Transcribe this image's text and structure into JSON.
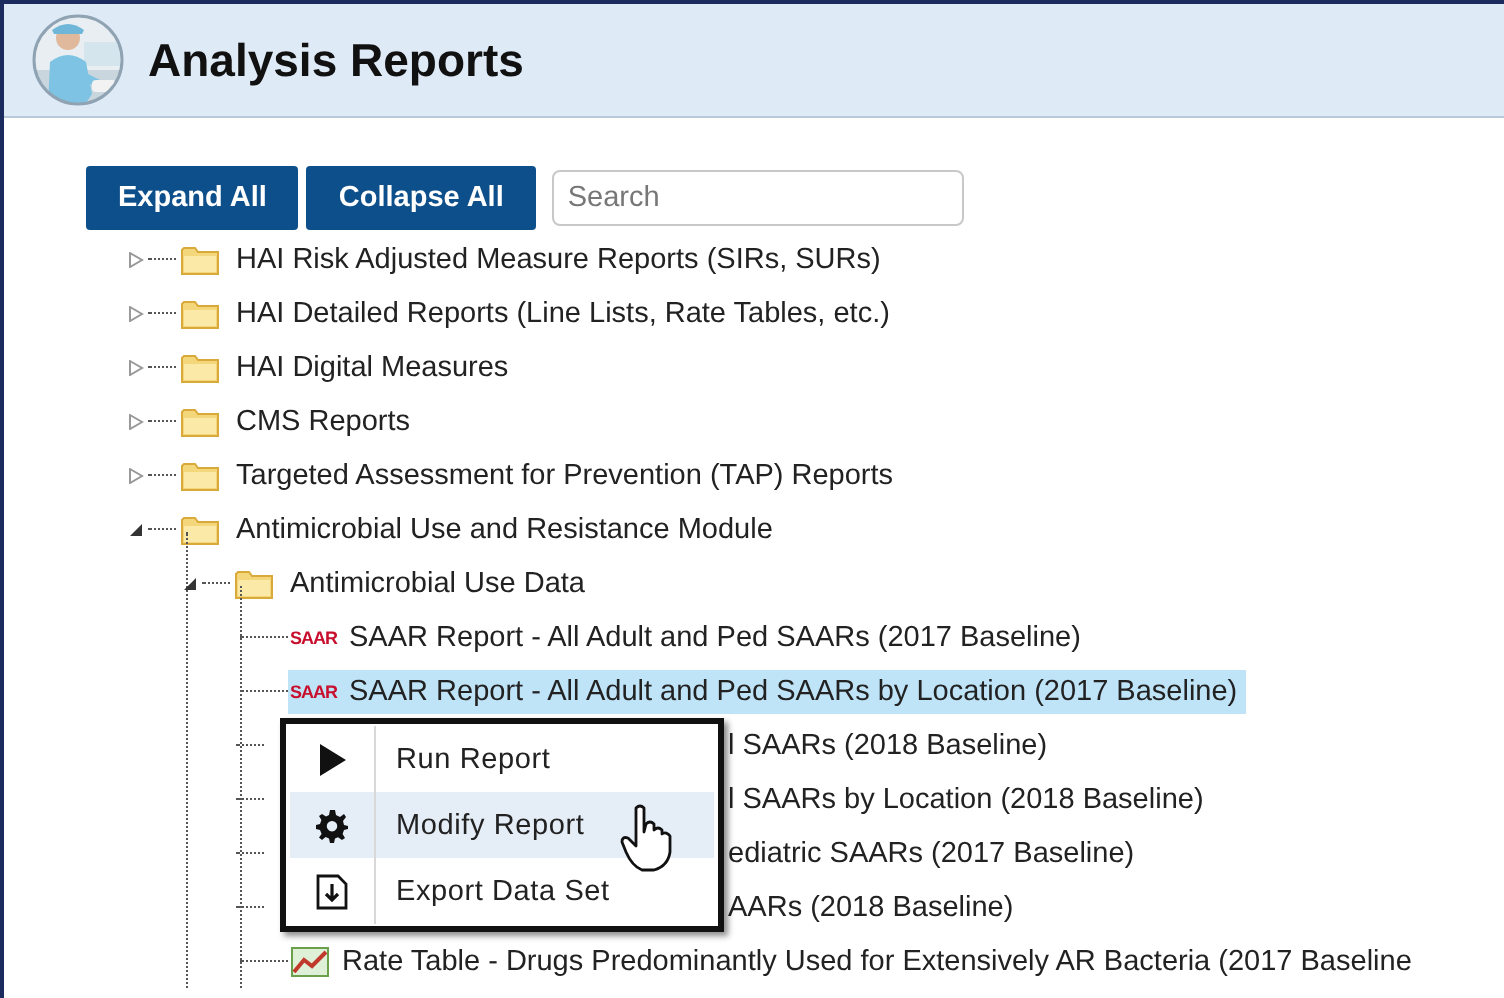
{
  "window": {
    "title": "Analysis Reports",
    "kind": "picture"
  },
  "toolbar": {
    "buttons": [
      "Expand All",
      "Collapse All"
    ],
    "search": {
      "placeholder": "Search"
    }
  },
  "tree": [
    {
      "kind": "folder",
      "label": "HAI Risk Adjusted Measure Reports (SIRs, SURs)",
      "expanded": false
    },
    {
      "kind": "folder",
      "label": "HAI Detailed Reports (Line Lists, Rate Tables, etc.)",
      "expanded": false
    },
    {
      "kind": "folder",
      "label": "HAI Digital Measures",
      "expanded": false
    },
    {
      "kind": "folder",
      "label": "CMS Reports",
      "expanded": false
    },
    {
      "kind": "folder",
      "label": "Targeted Assessment for Prevention (TAP) Reports",
      "expanded": false
    },
    {
      "kind": "folder",
      "label": "Antimicrobial Use and Resistance Module",
      "expanded": true,
      "children": [
        {
          "kind": "folder",
          "label": "Antimicrobial Use Data",
          "expanded": true,
          "children": [
            {
              "kind": "saar",
              "badge": "SAAR",
              "label": "SAAR Report - All Adult and Ped SAARs (2017 Baseline)",
              "selected": false
            },
            {
              "kind": "saar",
              "badge": "SAAR",
              "label": "SAAR Report - All Adult and Ped SAARs by Location (2017 Baseline)",
              "selected": true
            },
            {
              "kind": "covered",
              "label": "l SAARs (2018 Baseline)"
            },
            {
              "kind": "covered",
              "label": "l SAARs by Location (2018 Baseline)"
            },
            {
              "kind": "covered",
              "label": "ediatric SAARs (2017 Baseline)"
            },
            {
              "kind": "covered",
              "label": "AARs (2018 Baseline)"
            },
            {
              "kind": "chart",
              "label": "Rate Table - Drugs Predominantly Used for Extensively AR Bacteria (2017 Baseline",
              "selected": false
            }
          ]
        }
      ]
    }
  ],
  "context_menu": [
    {
      "kind": "run",
      "label": "Run Report",
      "selected": false
    },
    {
      "kind": "modify",
      "label": "Modify Report",
      "selected": true
    },
    {
      "kind": "export",
      "label": "Export Data Set",
      "selected": false
    }
  ]
}
